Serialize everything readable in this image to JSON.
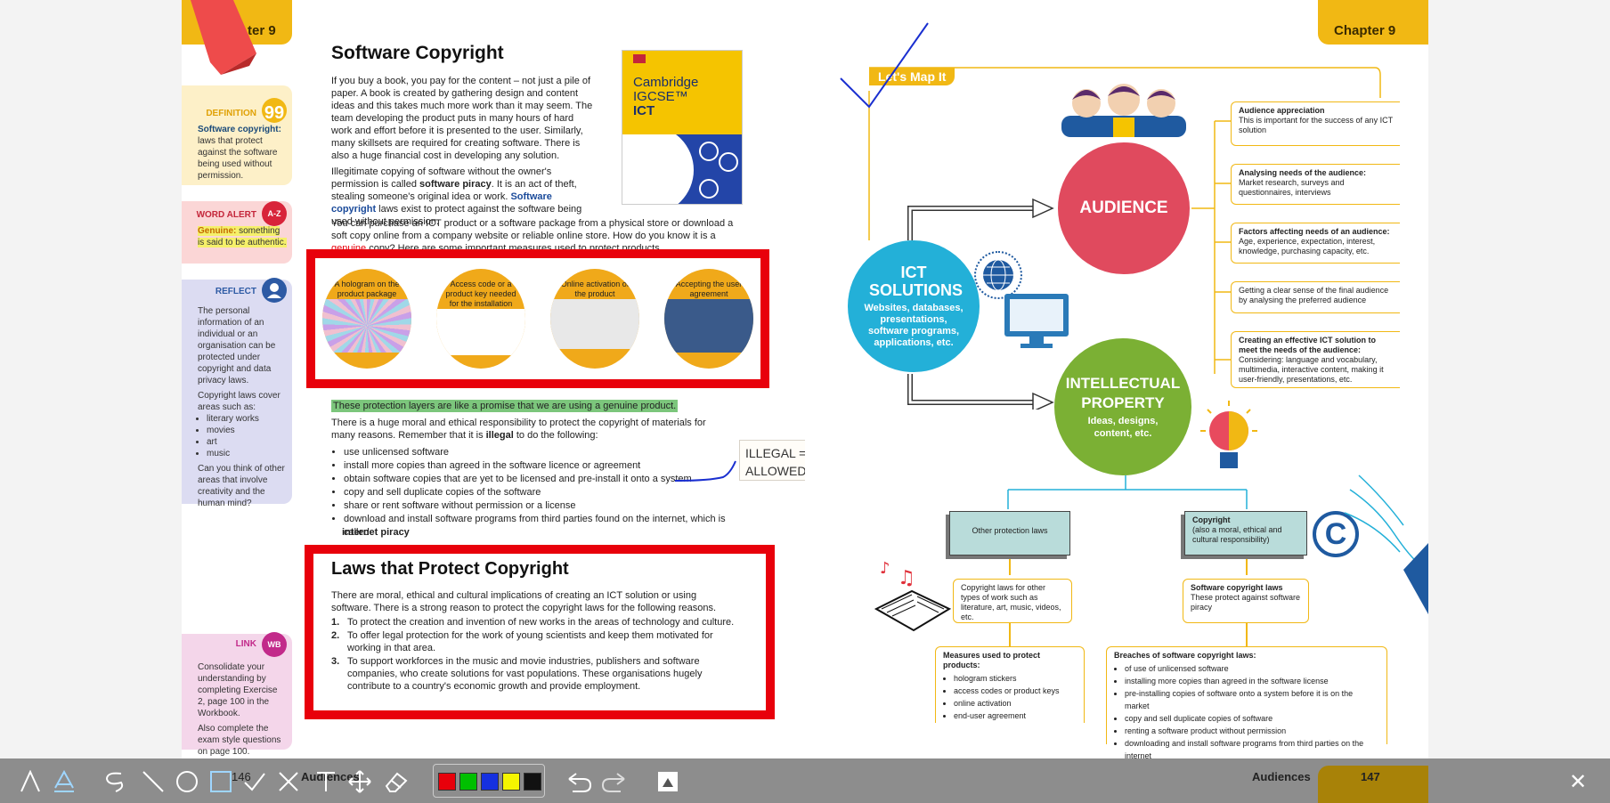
{
  "left_page": {
    "chapter_tab": "Chapter 9",
    "chapter_tab_visible": "ter 9",
    "title": "Software Copyright",
    "intro_p1": "If you buy a book, you pay for the content – not just a pile of paper. A book is created by gathering design and content ideas and this takes much more work than it may seem. The team developing the product puts in many hours of hard work and effort before it is presented to the user. Similarly, many skillsets are required for creating software. There is also a huge financial cost in developing any solution.",
    "intro_p2_a": "Illegitimate copying of software without the owner's permission is called ",
    "intro_p2_b": "software piracy",
    "intro_p2_c": ". It is an act of theft, stealing someone's original idea or work. ",
    "intro_p2_d": "Software copyright",
    "intro_p2_e": " laws exist to protect against the software being used without permission.",
    "intro_p3_a": "You can purchase an ICT product or a software package from a physical store or download a soft copy online from a company website or reliable online store. How do you know it is a ",
    "intro_p3_b": "genuine",
    "intro_p3_c": " copy? Here are some important measures used to protect products.",
    "book_cover": {
      "publisher": "Cambridge",
      "line1": "Cambridge",
      "line2": "IGCSE™",
      "line3": "ICT"
    },
    "measures": [
      {
        "label": "A hologram on the product package"
      },
      {
        "label": "Access code or a product key needed for the installation"
      },
      {
        "label": "Online activation of the product"
      },
      {
        "label": "Accepting the user agreement"
      }
    ],
    "highlight_text": "These protection layers are like a promise that we are using a genuine product.",
    "moral_p_a": "There is a huge moral and ethical responsibility to protect the copyright of materials for many reasons. Remember that it is ",
    "moral_p_b": "illegal",
    "moral_p_c": " to do the following:",
    "illegal_list": [
      "use unlicensed software",
      "install more copies than agreed in the software licence or agreement",
      "obtain software copies that are yet to be licensed and pre-install it onto a system",
      "copy and sell duplicate copies of the software",
      "share or rent software without permission or a license",
      "download and install software programs from third parties found on the internet, which is called"
    ],
    "internet_piracy": "internet piracy",
    "note_box": "ILLEGAL = NOT ALLOWED",
    "laws_title": "Laws that Protect Copyright",
    "laws_intro": "There are moral, ethical and cultural implications of creating an ICT solution or using software. There is a strong reason to protect the copyright laws for the following reasons.",
    "laws_list": [
      {
        "num": "1.",
        "text": "To protect the creation and invention of new works in the areas of technology and culture."
      },
      {
        "num": "2.",
        "text": "To offer legal protection for the work of young scientists and keep them motivated for working in that area."
      },
      {
        "num": "3.",
        "text": "To support workforces in the music and movie industries, publishers and software companies, who create solutions for vast populations. These organisations hugely contribute to a country's economic growth and provide employment."
      }
    ],
    "page_number": "146",
    "footer_label": "Audiences"
  },
  "sidebar": {
    "definition": {
      "title": "DEFINITION",
      "term": "Software copyright:",
      "text": "laws that protect against the software being used without permission."
    },
    "word_alert": {
      "title": "WORD ALERT",
      "icon_text": "A-Z",
      "term": "Genuine:",
      "text": "something is said to be authentic."
    },
    "reflect": {
      "title": "REFLECT",
      "p1": "The personal information of an individual or an organisation can be protected under copyright and data privacy laws.",
      "p2": "Copyright laws cover areas such as:",
      "items": [
        "literary works",
        "movies",
        "art",
        "music"
      ],
      "p3": "Can you think of other areas that involve creativity and the human mind?"
    },
    "link": {
      "title": "LINK",
      "icon_text": "WB",
      "p1": "Consolidate your understanding by completing Exercise 2, page 100 in the Workbook.",
      "p2": "Also complete the exam style questions on page 100."
    }
  },
  "right_page": {
    "chapter_tab": "Chapter 9",
    "lets_map_it": "Let's Map It",
    "audience": "AUDIENCE",
    "ict_title": "ICT SOLUTIONS",
    "ict_sub": "Websites, databases, presentations, software programs, applications, etc.",
    "ip_title": "INTELLECTUAL PROPERTY",
    "ip_sub": "Ideas, designs, content, etc.",
    "audience_boxes": [
      {
        "bold": "Audience appreciation",
        "text": "This is important for the success of any ICT solution"
      },
      {
        "bold": "Analysing needs of the audience:",
        "text": " Market research, surveys and questionnaires, interviews"
      },
      {
        "bold": "Factors affecting needs of an audience:",
        "text": " Age, experience, expectation, interest, knowledge, purchasing capacity, etc."
      },
      {
        "bold": "",
        "text": "Getting a clear sense of the final audience by analysing the preferred audience"
      },
      {
        "bold": "Creating an effective ICT solution to meet the needs of the audience:",
        "text": " Considering: language and vocabulary, multimedia, interactive content, making it user-friendly, presentations, etc."
      }
    ],
    "other_protection": "Other protection laws",
    "copyright_box_title": "Copyright",
    "copyright_box_sub": "(also a moral, ethical and cultural responsibility)",
    "copyright_other_types": "Copyright laws for other types of work such as literature, art, music, videos, etc.",
    "software_laws_title": "Software copyright laws",
    "software_laws_text": "These protect against software piracy",
    "measures_title": "Measures used to protect products:",
    "measures_list": [
      "hologram stickers",
      "access codes or product keys",
      "online activation",
      "end-user agreement"
    ],
    "breaches_title": "Breaches of software copyright laws:",
    "breaches_list": [
      "of use of unlicensed software",
      "installing more copies than agreed in the software license",
      "pre-installing copies of software onto a system before it is on the market",
      "copy and sell duplicate copies of software",
      "renting a software product without permission",
      "downloading and install software programs from third parties on the internet"
    ],
    "page_number": "147",
    "footer_label": "Audiences"
  },
  "toolbar": {
    "colors": [
      "#e8000b",
      "#00c000",
      "#1530e0",
      "#f5f500",
      "#111111"
    ],
    "active_tool": "rectangle",
    "close_label": "✕"
  },
  "annotation_colors": {
    "red": "#e8000b",
    "pen_blue": "#1a2fd0",
    "highlight": "#7cc67c"
  }
}
